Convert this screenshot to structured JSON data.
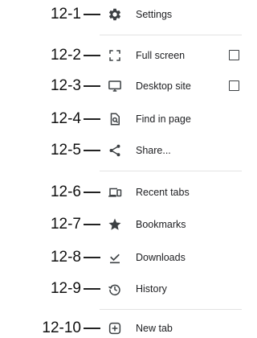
{
  "menu": {
    "items": [
      {
        "callout": "12-1",
        "label": "Settings",
        "icon": "gear-icon",
        "checkbox": false
      },
      {
        "callout": "12-2",
        "label": "Full screen",
        "icon": "fullscreen-icon",
        "checkbox": true,
        "checked": false
      },
      {
        "callout": "12-3",
        "label": "Desktop site",
        "icon": "monitor-icon",
        "checkbox": true,
        "checked": false
      },
      {
        "callout": "12-4",
        "label": "Find in page",
        "icon": "find-in-page-icon",
        "checkbox": false
      },
      {
        "callout": "12-5",
        "label": "Share...",
        "icon": "share-icon",
        "checkbox": false
      },
      {
        "callout": "12-6",
        "label": "Recent tabs",
        "icon": "recent-tabs-icon",
        "checkbox": false
      },
      {
        "callout": "12-7",
        "label": "Bookmarks",
        "icon": "star-icon",
        "checkbox": false
      },
      {
        "callout": "12-8",
        "label": "Downloads",
        "icon": "download-icon",
        "checkbox": false
      },
      {
        "callout": "12-9",
        "label": "History",
        "icon": "history-icon",
        "checkbox": false
      },
      {
        "callout": "12-10",
        "label": "New tab",
        "icon": "plus-box-icon",
        "checkbox": false
      }
    ]
  },
  "colors": {
    "icon": "#3c4043",
    "text": "#202124",
    "divider": "#e3e3e3"
  }
}
